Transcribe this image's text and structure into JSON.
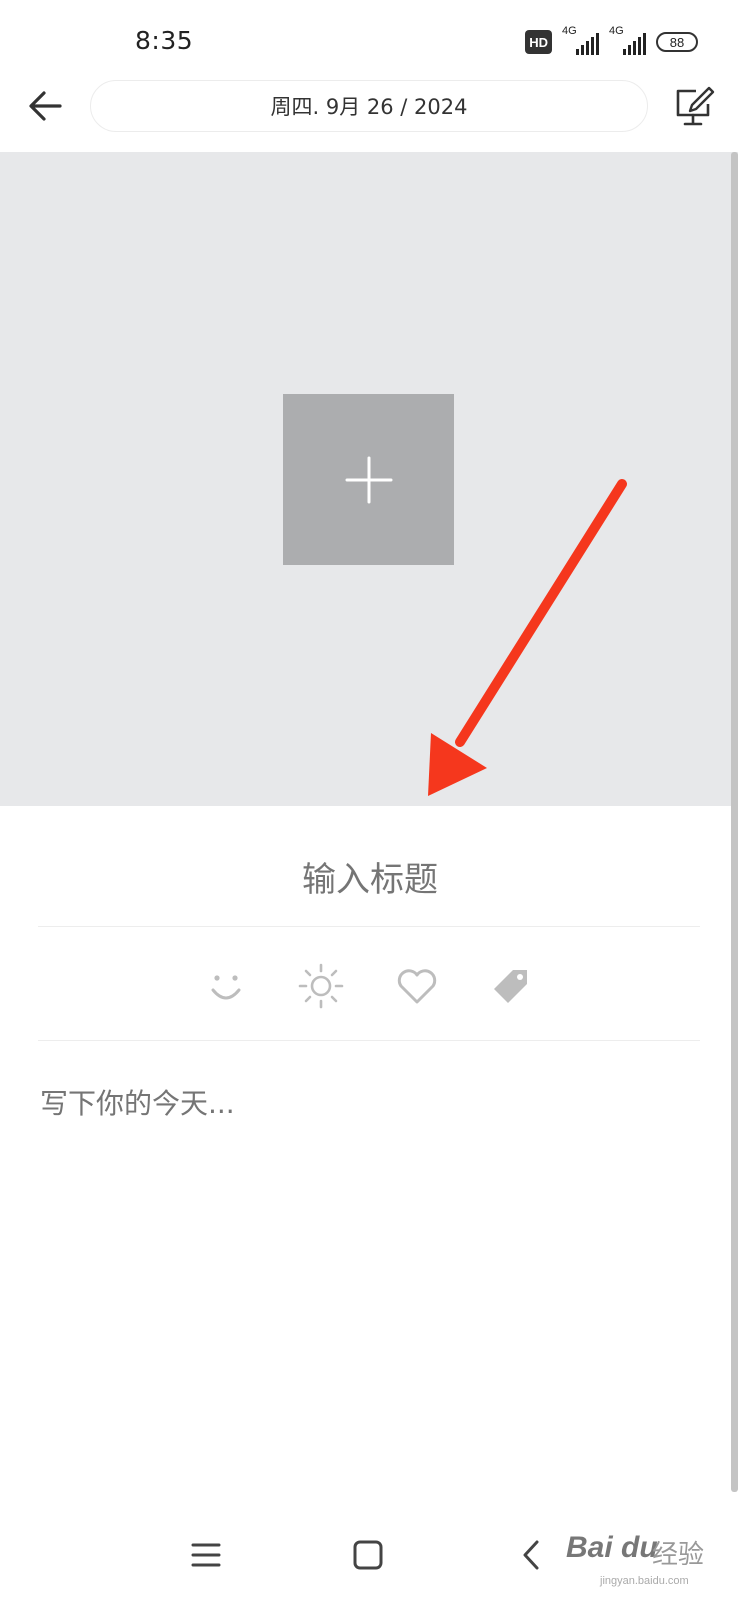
{
  "status_bar": {
    "time": "8:35",
    "hd_badge": "HD",
    "network_1": "4G",
    "network_2": "4G",
    "battery": "88"
  },
  "header": {
    "date": "周四. 9月 26 / 2024",
    "back_icon": "arrow-left-icon",
    "edit_icon": "edit-monitor-icon"
  },
  "cover": {
    "add_icon": "plus-icon"
  },
  "editor": {
    "title_placeholder": "输入标题",
    "body_placeholder": "写下你的今天...",
    "attribute_icons": [
      "smile-icon",
      "sun-icon",
      "heart-icon",
      "tag-icon"
    ]
  },
  "nav": {
    "menu_icon": "menu-icon",
    "home_icon": "square-home-icon",
    "back_icon": "chevron-left-icon"
  },
  "watermark": {
    "brand": "Bai du",
    "cn": "经验",
    "sub": "jingyan.baidu.com"
  },
  "colors": {
    "cover_bg": "#e7e8ea",
    "add_button_bg": "#acadaf",
    "arrow": "#f5371d",
    "placeholder": "#b8b8b8"
  }
}
